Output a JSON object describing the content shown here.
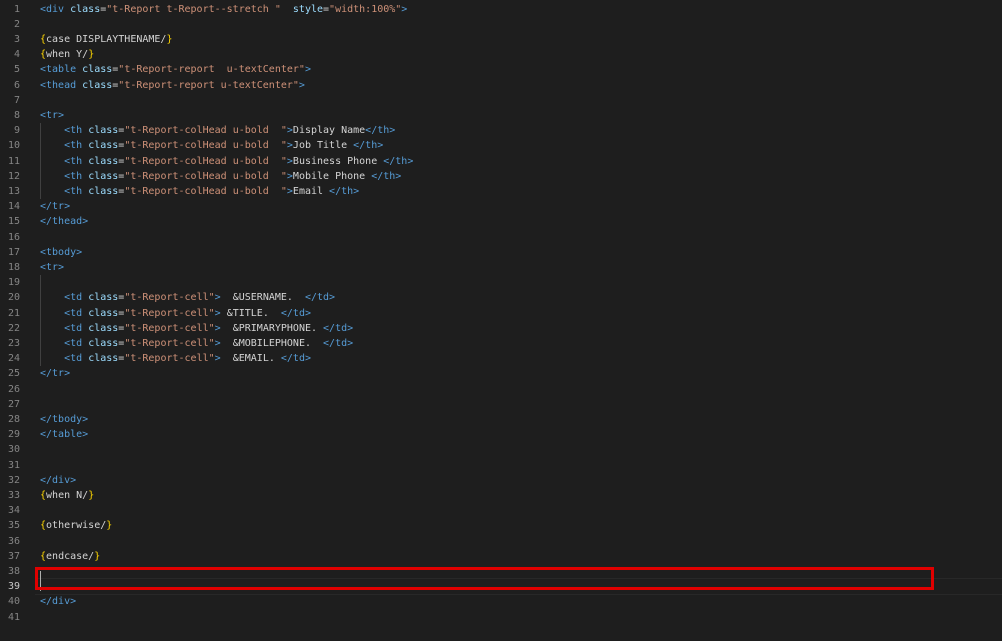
{
  "editor": {
    "cursor_line": 39,
    "lines": [
      [
        [
          "tag",
          "<div "
        ],
        [
          "attr",
          "class"
        ],
        [
          "text",
          "="
        ],
        [
          "str",
          "\"t-Report t-Report--stretch \""
        ],
        [
          "text",
          "  "
        ],
        [
          "attr",
          "style"
        ],
        [
          "text",
          "="
        ],
        [
          "str",
          "\"width:100%\""
        ],
        [
          "tag",
          ">"
        ]
      ],
      [],
      [
        [
          "brace",
          "{"
        ],
        [
          "text",
          "case DISPLAYTHENAME/"
        ],
        [
          "brace",
          "}"
        ]
      ],
      [
        [
          "brace",
          "{"
        ],
        [
          "text",
          "when Y/"
        ],
        [
          "brace",
          "}"
        ]
      ],
      [
        [
          "tag",
          "<table "
        ],
        [
          "attr",
          "class"
        ],
        [
          "text",
          "="
        ],
        [
          "str",
          "\"t-Report-report  u-textCenter\""
        ],
        [
          "tag",
          ">"
        ]
      ],
      [
        [
          "tag",
          "<thead "
        ],
        [
          "attr",
          "class"
        ],
        [
          "text",
          "="
        ],
        [
          "str",
          "\"t-Report-report u-textCenter\""
        ],
        [
          "tag",
          ">"
        ]
      ],
      [],
      [
        [
          "tag",
          "<tr>"
        ]
      ],
      [
        [
          "text",
          "    "
        ],
        [
          "tag",
          "<th "
        ],
        [
          "attr",
          "class"
        ],
        [
          "text",
          "="
        ],
        [
          "str",
          "\"t-Report-colHead u-bold  \""
        ],
        [
          "tag",
          ">"
        ],
        [
          "text",
          "Display Name"
        ],
        [
          "tag",
          "</th>"
        ]
      ],
      [
        [
          "text",
          "    "
        ],
        [
          "tag",
          "<th "
        ],
        [
          "attr",
          "class"
        ],
        [
          "text",
          "="
        ],
        [
          "str",
          "\"t-Report-colHead u-bold  \""
        ],
        [
          "tag",
          ">"
        ],
        [
          "text",
          "Job Title "
        ],
        [
          "tag",
          "</th>"
        ]
      ],
      [
        [
          "text",
          "    "
        ],
        [
          "tag",
          "<th "
        ],
        [
          "attr",
          "class"
        ],
        [
          "text",
          "="
        ],
        [
          "str",
          "\"t-Report-colHead u-bold  \""
        ],
        [
          "tag",
          ">"
        ],
        [
          "text",
          "Business Phone "
        ],
        [
          "tag",
          "</th>"
        ]
      ],
      [
        [
          "text",
          "    "
        ],
        [
          "tag",
          "<th "
        ],
        [
          "attr",
          "class"
        ],
        [
          "text",
          "="
        ],
        [
          "str",
          "\"t-Report-colHead u-bold  \""
        ],
        [
          "tag",
          ">"
        ],
        [
          "text",
          "Mobile Phone "
        ],
        [
          "tag",
          "</th>"
        ]
      ],
      [
        [
          "text",
          "    "
        ],
        [
          "tag",
          "<th "
        ],
        [
          "attr",
          "class"
        ],
        [
          "text",
          "="
        ],
        [
          "str",
          "\"t-Report-colHead u-bold  \""
        ],
        [
          "tag",
          ">"
        ],
        [
          "text",
          "Email "
        ],
        [
          "tag",
          "</th>"
        ]
      ],
      [
        [
          "tag",
          "</tr>"
        ]
      ],
      [
        [
          "tag",
          "</thead>"
        ]
      ],
      [],
      [
        [
          "tag",
          "<tbody>"
        ]
      ],
      [
        [
          "tag",
          "<tr>"
        ]
      ],
      [],
      [
        [
          "text",
          "    "
        ],
        [
          "tag",
          "<td "
        ],
        [
          "attr",
          "class"
        ],
        [
          "text",
          "="
        ],
        [
          "str",
          "\"t-Report-cell\""
        ],
        [
          "tag",
          ">"
        ],
        [
          "text",
          "  &USERNAME.  "
        ],
        [
          "tag",
          "</td>"
        ]
      ],
      [
        [
          "text",
          "    "
        ],
        [
          "tag",
          "<td "
        ],
        [
          "attr",
          "class"
        ],
        [
          "text",
          "="
        ],
        [
          "str",
          "\"t-Report-cell\""
        ],
        [
          "tag",
          ">"
        ],
        [
          "text",
          " &TITLE.  "
        ],
        [
          "tag",
          "</td>"
        ]
      ],
      [
        [
          "text",
          "    "
        ],
        [
          "tag",
          "<td "
        ],
        [
          "attr",
          "class"
        ],
        [
          "text",
          "="
        ],
        [
          "str",
          "\"t-Report-cell\""
        ],
        [
          "tag",
          ">"
        ],
        [
          "text",
          "  &PRIMARYPHONE. "
        ],
        [
          "tag",
          "</td>"
        ]
      ],
      [
        [
          "text",
          "    "
        ],
        [
          "tag",
          "<td "
        ],
        [
          "attr",
          "class"
        ],
        [
          "text",
          "="
        ],
        [
          "str",
          "\"t-Report-cell\""
        ],
        [
          "tag",
          ">"
        ],
        [
          "text",
          "  &MOBILEPHONE.  "
        ],
        [
          "tag",
          "</td>"
        ]
      ],
      [
        [
          "text",
          "    "
        ],
        [
          "tag",
          "<td "
        ],
        [
          "attr",
          "class"
        ],
        [
          "text",
          "="
        ],
        [
          "str",
          "\"t-Report-cell\""
        ],
        [
          "tag",
          ">"
        ],
        [
          "text",
          "  &EMAIL. "
        ],
        [
          "tag",
          "</td>"
        ]
      ],
      [
        [
          "tag",
          "</tr>"
        ]
      ],
      [],
      [],
      [
        [
          "tag",
          "</tbody>"
        ]
      ],
      [
        [
          "tag",
          "</table>"
        ]
      ],
      [],
      [],
      [
        [
          "tag",
          "</div>"
        ]
      ],
      [
        [
          "brace",
          "{"
        ],
        [
          "text",
          "when N/"
        ],
        [
          "brace",
          "}"
        ]
      ],
      [],
      [
        [
          "brace",
          "{"
        ],
        [
          "text",
          "otherwise/"
        ],
        [
          "brace",
          "}"
        ]
      ],
      [],
      [
        [
          "brace",
          "{"
        ],
        [
          "text",
          "endcase/"
        ],
        [
          "brace",
          "}"
        ]
      ],
      [],
      [],
      [
        [
          "tag",
          "</div>"
        ]
      ],
      []
    ]
  },
  "colors": {
    "background": "#1e1e1e",
    "tag": "#569cd6",
    "attr": "#9cdcfe",
    "string": "#ce9178",
    "brace": "#ffd700",
    "text": "#d4d4d4",
    "line_number": "#858585",
    "highlight_box": "#e00000"
  }
}
